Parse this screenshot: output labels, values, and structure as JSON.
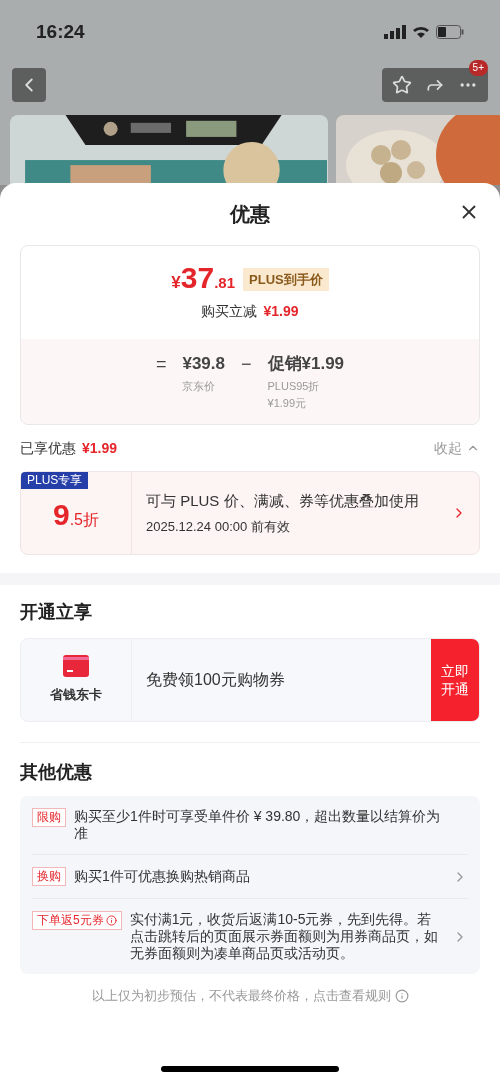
{
  "status_bar": {
    "time": "16:24"
  },
  "nav": {
    "badge": "5+"
  },
  "sheet": {
    "title": "优惠",
    "price_card": {
      "currency": "¥",
      "integer": "37",
      "decimal": ".81",
      "tag": "PLUS到手价",
      "reduce_label": "购买立减",
      "reduce_amount": "¥1.99",
      "formula": [
        {
          "kind": "op",
          "text": "="
        },
        {
          "kind": "term",
          "text": "¥39.8",
          "note": [
            "京东价"
          ]
        },
        {
          "kind": "op",
          "text": "−"
        },
        {
          "kind": "term",
          "text": "促销¥1.99",
          "note": [
            "PLUS95折",
            "¥1.99元"
          ]
        }
      ]
    },
    "enjoyed": {
      "label": "已享优惠",
      "amount": "¥1.99",
      "toggle": "收起",
      "expanded": true
    },
    "plus_coupon": {
      "badge": "PLUS专享",
      "big": "9",
      "small": ".5折",
      "title": "可与 PLUS 价、满减、券等优惠叠加使用",
      "validity": "2025.12.24 00:00 前有效"
    },
    "open_section": {
      "heading": "开通立享",
      "card_name": "省钱东卡",
      "offer": "免费领100元购物券",
      "button": "立即开通"
    },
    "other_section": {
      "heading": "其他优惠",
      "items": [
        {
          "tag": "限购",
          "text": "购买至少1件时可享受单件价 ¥ 39.80，超出数量以结算价为准",
          "info": false,
          "arrow": false
        },
        {
          "tag": "换购",
          "text": "购买1件可优惠换购热销商品",
          "info": false,
          "arrow": true
        },
        {
          "tag": "下单返5元券",
          "text": "实付满1元，收货后返满10-5元券，先到先得。若点击跳转后的页面展示券面额则为用券商品页，如无券面额则为凑单商品页或活动页。",
          "info": true,
          "arrow": true
        }
      ]
    },
    "footer": "以上仅为初步预估，不代表最终价格，点击查看规则"
  }
}
